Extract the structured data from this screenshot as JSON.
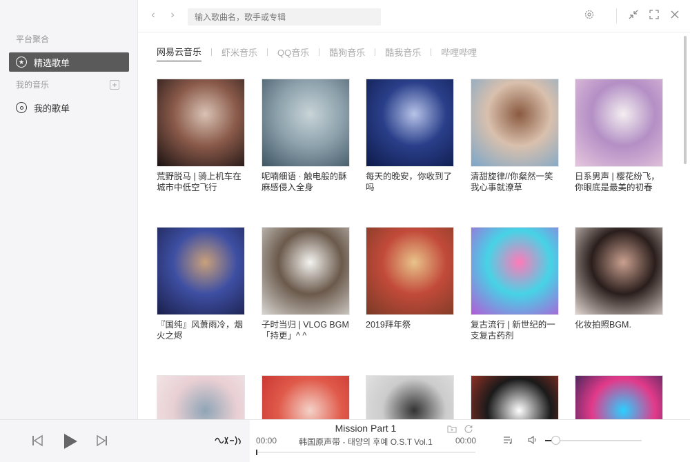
{
  "sidebar": {
    "section_platform": "平台聚合",
    "featured_label": "精选歌单",
    "section_my_music": "我的音乐",
    "add_label": "+",
    "my_playlists_label": "我的歌单"
  },
  "topbar": {
    "back": "‹",
    "forward": "›",
    "search_placeholder": "输入歌曲名，歌手或专辑"
  },
  "tabs": [
    "网易云音乐",
    "虾米音乐",
    "QQ音乐",
    "酷狗音乐",
    "酷我音乐",
    "哔哩哔哩"
  ],
  "playlists": [
    {
      "title": "荒野脱马 | 骑上机车在城市中低空飞行",
      "colors": [
        "#1b1212",
        "#8a5a4a",
        "#d9c2b4"
      ]
    },
    {
      "title": "呢喃细语 · 触电般的酥麻感侵入全身",
      "colors": [
        "#3f5563",
        "#8ea3ad",
        "#c8d4d8"
      ]
    },
    {
      "title": "每天的晚安，你收到了吗",
      "colors": [
        "#0d1a4a",
        "#2a3f8a",
        "#b6c3e8"
      ]
    },
    {
      "title": "清甜旋律//你粲然一笑 我心事就潦草",
      "colors": [
        "#7aa6c9",
        "#d9c0ad",
        "#8a5a40"
      ]
    },
    {
      "title": "日系男声 | 樱花纷飞，你眼底是最美的初春",
      "colors": [
        "#e6c6dd",
        "#b38fc5",
        "#f3eef0"
      ]
    },
    {
      "title": "『国纯』风萧雨冷，烟火之烬",
      "colors": [
        "#1a1f4a",
        "#3e4fa3",
        "#c9a07a"
      ]
    },
    {
      "title": "子时当归 | VLOG BGM「持更」^ ^",
      "colors": [
        "#d8d6d2",
        "#6b5a4c",
        "#f4f3f0"
      ]
    },
    {
      "title": "2019拜年祭",
      "colors": [
        "#7a3a26",
        "#c24a3a",
        "#e8c38a"
      ]
    },
    {
      "title": "复古流行 | 新世纪的一支复古药剂",
      "colors": [
        "#b45ad6",
        "#46d3e6",
        "#ff7ab8"
      ]
    },
    {
      "title": "化妆拍照BGM.",
      "colors": [
        "#e3d8d3",
        "#2a1e1c",
        "#c9a08f"
      ]
    },
    {
      "title": "",
      "colors": [
        "#f5ecec",
        "#e8cfd3",
        "#8fa5b6"
      ]
    },
    {
      "title": "",
      "colors": [
        "#c22a2a",
        "#e05a4a",
        "#f4d2c8"
      ]
    },
    {
      "title": "",
      "colors": [
        "#e8e8e8",
        "#cccccc",
        "#333333"
      ]
    },
    {
      "title": "",
      "colors": [
        "#c23a2a",
        "#1a1a1a",
        "#ffffff"
      ]
    },
    {
      "title": "",
      "colors": [
        "#0e1f4a",
        "#e23a8a",
        "#2ad0ff"
      ]
    }
  ],
  "player": {
    "logo_text": "ᛪᛘ天ᛇ ᚠᚾ",
    "song_title": "Mission Part 1",
    "song_artist": "韩国原声带 - 태양의 후예 O.S.T Vol.1",
    "time_current": "00:00",
    "time_total": "00:00",
    "progress": 0.0,
    "volume": 0.08
  }
}
